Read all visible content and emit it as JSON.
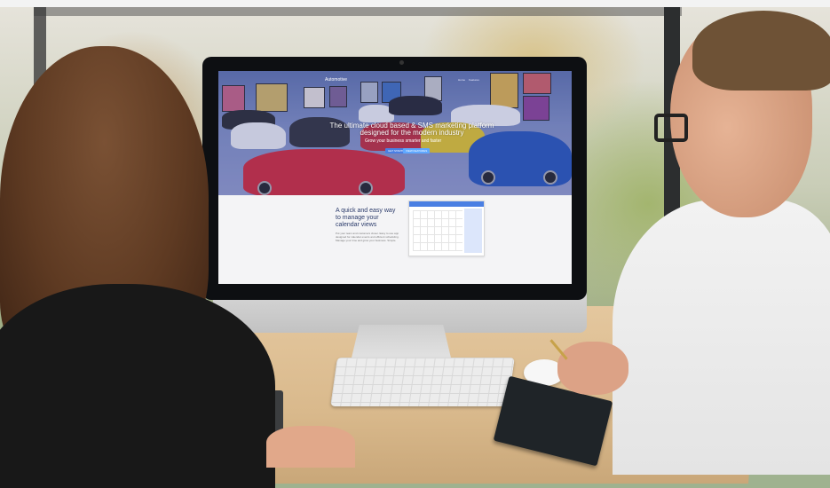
{
  "screen": {
    "nav": {
      "brand": "Automotive",
      "links": [
        "Home",
        "Features"
      ]
    },
    "hero": {
      "title": "The ultimate cloud based & SMS marketing platform designed for the modern industry",
      "subtitle": "Grow your business smarter and faster",
      "buttons": [
        "GET STARTED",
        "VIEW FEATURES"
      ]
    },
    "section": {
      "heading": "A quick and easy way to manage your calendar views",
      "body": "Put your team and customers closer. Easy to use app designed for calendar events and efficient scheduling. Manage your time and grow your business. Simple."
    }
  },
  "colors": {
    "hero_tint": "#5b6ea6",
    "accent_blue": "#4a7fe3",
    "heading_text": "#2a3a6a",
    "monitor_bezel": "#0d0f12"
  }
}
